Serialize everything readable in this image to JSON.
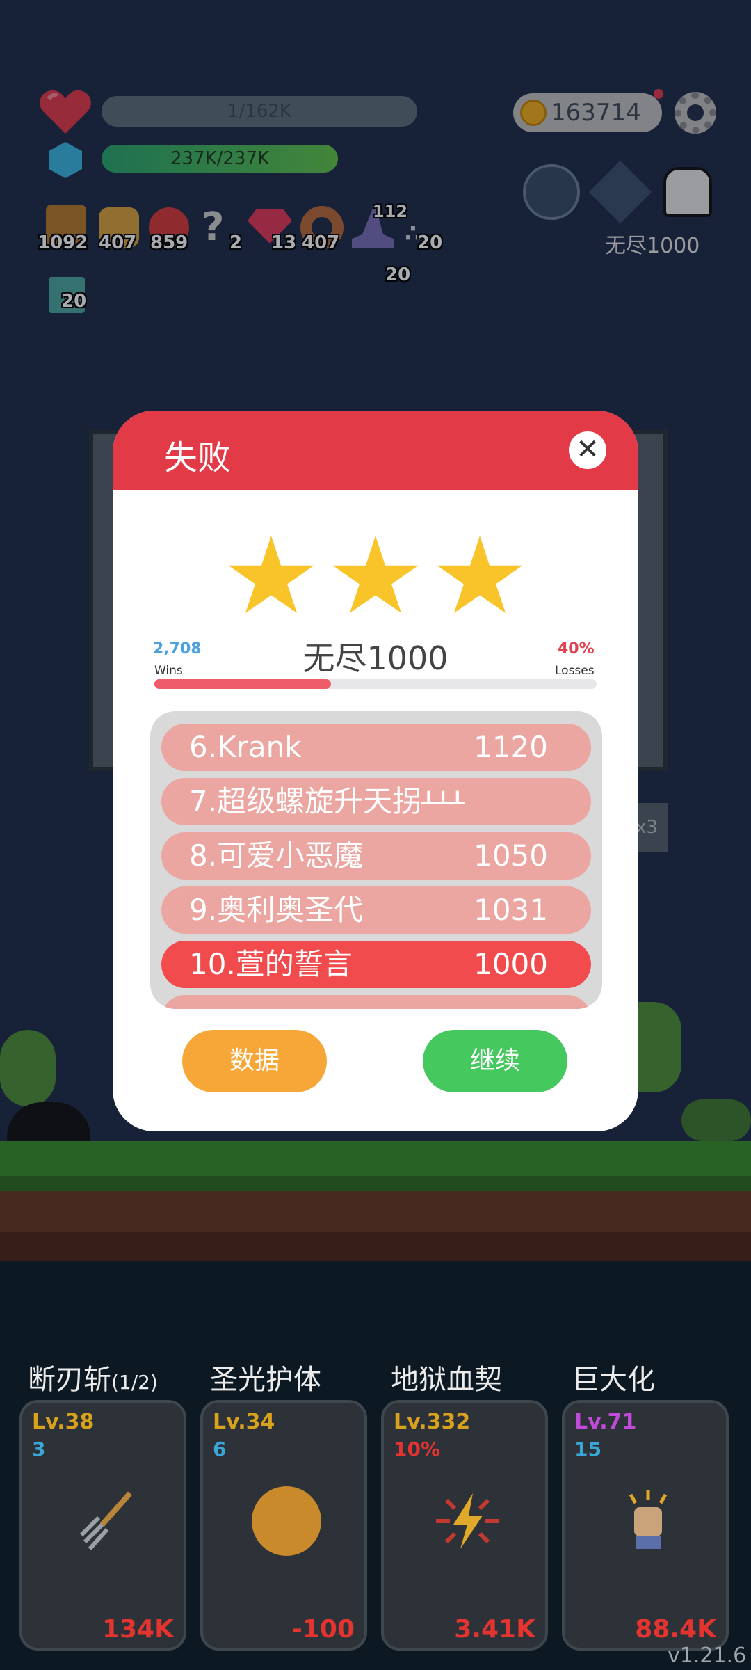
{
  "hud": {
    "hp_text": "1/162K",
    "exp_text": "237K/237K",
    "coins": "163714",
    "stage_label": "无尽1000",
    "items": [
      {
        "icon": "book-icon",
        "count": "1092"
      },
      {
        "icon": "beer-icon",
        "count": "407"
      },
      {
        "icon": "apple-icon",
        "count": "859"
      },
      {
        "icon": "hook-icon",
        "count": "2"
      },
      {
        "icon": "gem-icon",
        "count": "13"
      },
      {
        "icon": "donut-icon",
        "count": "407"
      },
      {
        "icon": "wizard-hat-icon",
        "count": "20",
        "badge": "112"
      },
      {
        "icon": "dots-icon",
        "count": "20"
      }
    ],
    "extra_item": {
      "icon": "map-icon",
      "count": "20"
    }
  },
  "dialog": {
    "title": "失败",
    "close_icon": "close-icon",
    "stars": 3,
    "wins_value": "2,708",
    "wins_label": "Wins",
    "losses_value": "40%",
    "losses_label": "Losses",
    "progress_fraction": 0.4,
    "stage_title": "无尽1000",
    "leaderboard": [
      {
        "rank_name": "6.Krank",
        "score": "1120"
      },
      {
        "rank_name": "7.超级螺旋升天拐ᚆᚆᚆ",
        "score": ""
      },
      {
        "rank_name": "8.可爱小恶魔",
        "score": "1050"
      },
      {
        "rank_name": "9.奥利奥圣代",
        "score": "1031"
      },
      {
        "rank_name": "10.萱的誓言",
        "score": "1000",
        "highlight": true
      }
    ],
    "btn_data": "数据",
    "btn_continue": "继续"
  },
  "side_label": "x3",
  "skills": [
    {
      "name": "断刃斩",
      "suffix": "(1/2)",
      "level": "Lv.38",
      "sub": "3",
      "cost": "134K",
      "level_color": "#d8a21c",
      "sub_color": "#39a8d8",
      "icon": "pitchfork-icon"
    },
    {
      "name": "圣光护体",
      "suffix": "",
      "level": "Lv.34",
      "sub": "6",
      "cost": "-100",
      "level_color": "#d8a21c",
      "sub_color": "#39a8d8",
      "icon": "shield-glow-icon"
    },
    {
      "name": "地狱血契",
      "suffix": "",
      "level": "Lv.332",
      "sub": "10%",
      "cost": "3.41K",
      "level_color": "#d8a21c",
      "sub_color": "#e3342f",
      "icon": "lightning-icon"
    },
    {
      "name": "巨大化",
      "suffix": "",
      "level": "Lv.71",
      "sub": "15",
      "cost": "88.4K",
      "level_color": "#c04bd8",
      "sub_color": "#39a8d8",
      "icon": "fist-icon"
    }
  ],
  "version": "v1.21.6"
}
